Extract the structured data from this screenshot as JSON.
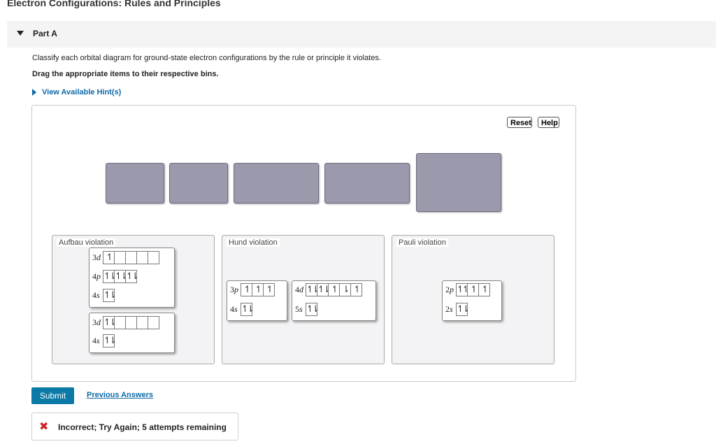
{
  "page": {
    "title": "Electron Configurations: Rules and Principles"
  },
  "part": {
    "label": "Part A",
    "expanded": true
  },
  "instructions": {
    "text": "Classify each orbital diagram for ground-state electron configurations by the rule or principle it violates.",
    "drag_text": "Drag the appropriate items to their respective bins."
  },
  "hint": {
    "label": "View Available Hint(s)"
  },
  "toolbar": {
    "reset_label": "Reset",
    "help_label": "Help"
  },
  "colors": {
    "slot": "#9b99ac",
    "accent": "#0c7aa6",
    "link": "#0d6aa8",
    "error": "#d2212a"
  },
  "bins": [
    {
      "title": "Aufbau violation",
      "cards": [
        {
          "rows": [
            {
              "orbital": "3d",
              "boxes": [
                "↿",
                "",
                "",
                "",
                ""
              ]
            },
            {
              "orbital": "4p",
              "boxes": [
                "↿⇂",
                "↿⇂",
                "↿⇂"
              ]
            },
            {
              "orbital": "4s",
              "boxes": [
                "↿⇂"
              ]
            }
          ]
        },
        {
          "rows": [
            {
              "orbital": "3d",
              "boxes": [
                "↿⇂",
                "",
                "",
                "",
                ""
              ]
            },
            {
              "orbital": "4s",
              "boxes": [
                "↿⇂"
              ]
            }
          ]
        }
      ]
    },
    {
      "title": "Hund violation",
      "cards": [
        {
          "rows": [
            {
              "orbital": "3p",
              "boxes": [
                "↿",
                "↿",
                "↿"
              ]
            },
            {
              "orbital": "4s",
              "boxes": [
                "↿⇂"
              ]
            }
          ]
        },
        {
          "rows": [
            {
              "orbital": "4d",
              "boxes": [
                "↿⇂",
                "↿⇂",
                "↿",
                "⇂",
                "↿"
              ]
            },
            {
              "orbital": "5s",
              "boxes": [
                "↿⇂"
              ]
            }
          ]
        }
      ]
    },
    {
      "title": "Pauli violation",
      "cards": [
        {
          "rows": [
            {
              "orbital": "2p",
              "boxes": [
                "↿↿",
                "↿",
                "↿"
              ]
            },
            {
              "orbital": "2s",
              "boxes": [
                "↿⇂"
              ]
            }
          ]
        }
      ]
    }
  ],
  "actions": {
    "submit_label": "Submit",
    "previous_answers_label": "Previous Answers"
  },
  "feedback": {
    "icon": "x-icon",
    "text": "Incorrect; Try Again; 5 attempts remaining"
  }
}
